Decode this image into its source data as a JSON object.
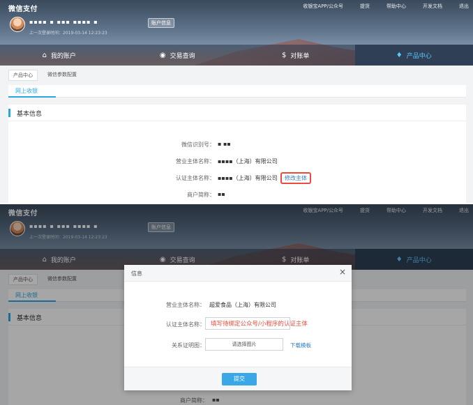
{
  "header": {
    "logo": "微信支付",
    "top_links": [
      "收银宝APP/公众号",
      "提货",
      "帮助中心",
      "开发文档",
      "退出"
    ],
    "merchant_name": "▪▪▪▪ ▪ ▪▪▪ ▪▪▪▪ ▪",
    "account_badge": "账户信息",
    "last_login": "上一次登录时间：2019-03-14 12:23:23"
  },
  "nav": [
    {
      "label": "我的账户",
      "icon": "home-icon"
    },
    {
      "label": "交易查询",
      "icon": "search-icon"
    },
    {
      "label": "对账单",
      "icon": "bill-icon"
    },
    {
      "label": "产品中心",
      "icon": "bulb-icon"
    }
  ],
  "crumbs": [
    "产品中心",
    "微信参数配置"
  ],
  "tab_label": "网上收银",
  "panel_title": "基本信息",
  "info": {
    "wechat_id_label": "微信识别号：",
    "wechat_id_value": "▪ ▪▪",
    "business_label": "营业主体名称：",
    "business_value": "▪▪▪▪（上海）有限公司",
    "auth_label": "认证主体名称：",
    "auth_value": "▪▪▪▪（上海）有限公司",
    "edit_link": "修改主体",
    "short_label": "商户简称：",
    "short_value": "▪▪"
  },
  "modal": {
    "title": "信息",
    "business_label": "营业主体名称：",
    "business_value": "超爱食品（上海）有限公司",
    "auth_label": "认证主体名称：",
    "auth_hint": "填写待绑定公众号/小程序的认证主体",
    "proof_label": "关系证明图：",
    "upload_label": "请选择图片",
    "template_link": "下载模板",
    "submit": "提交"
  }
}
